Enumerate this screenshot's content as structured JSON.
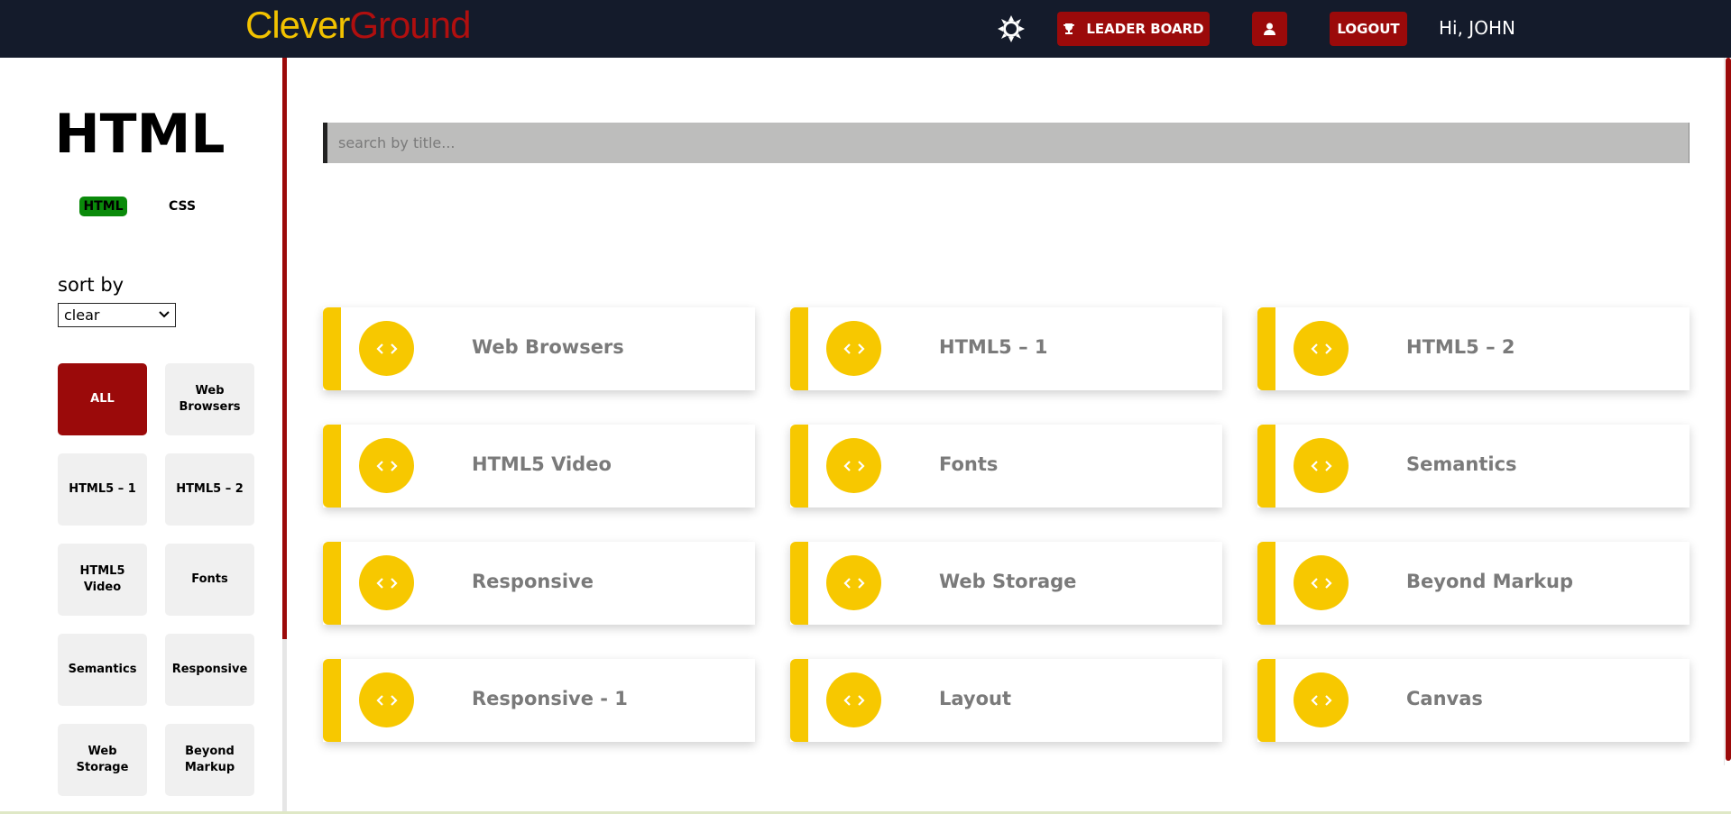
{
  "brand": {
    "part1": "Clever",
    "part2": "Ground"
  },
  "header": {
    "leaderboard_label": "LEADER BOARD",
    "logout_label": "LOGOUT",
    "greeting": "Hi, JOHN",
    "theme_icon": "sun-icon",
    "profile_icon": "user-icon",
    "leaderboard_icon": "trophy-icon"
  },
  "sidebar": {
    "title": "HTML",
    "tabs": [
      {
        "label": "HTML",
        "active": true
      },
      {
        "label": "CSS",
        "active": false
      }
    ],
    "sort_label": "sort by",
    "sort_value": "clear",
    "filters": [
      {
        "label": "ALL",
        "active": true
      },
      {
        "label": "Web Browsers"
      },
      {
        "label": "HTML5 – 1"
      },
      {
        "label": "HTML5 – 2"
      },
      {
        "label": "HTML5 Video"
      },
      {
        "label": "Fonts"
      },
      {
        "label": "Semantics"
      },
      {
        "label": "Responsive"
      },
      {
        "label": "Web Storage"
      },
      {
        "label": "Beyond Markup"
      }
    ]
  },
  "search": {
    "placeholder": "search by title..."
  },
  "cards": [
    {
      "title": "Web Browsers"
    },
    {
      "title": "HTML5 – 1"
    },
    {
      "title": "HTML5 – 2"
    },
    {
      "title": "HTML5 Video"
    },
    {
      "title": "Fonts"
    },
    {
      "title": "Semantics"
    },
    {
      "title": "Responsive"
    },
    {
      "title": "Web Storage"
    },
    {
      "title": "Beyond Markup"
    },
    {
      "title": "Responsive - 1"
    },
    {
      "title": "Layout"
    },
    {
      "title": "Canvas"
    }
  ],
  "colors": {
    "nav_bg": "#141b2b",
    "accent_red": "#9b0a0a",
    "accent_yellow": "#f7c800",
    "active_green": "#0a8a0a"
  }
}
